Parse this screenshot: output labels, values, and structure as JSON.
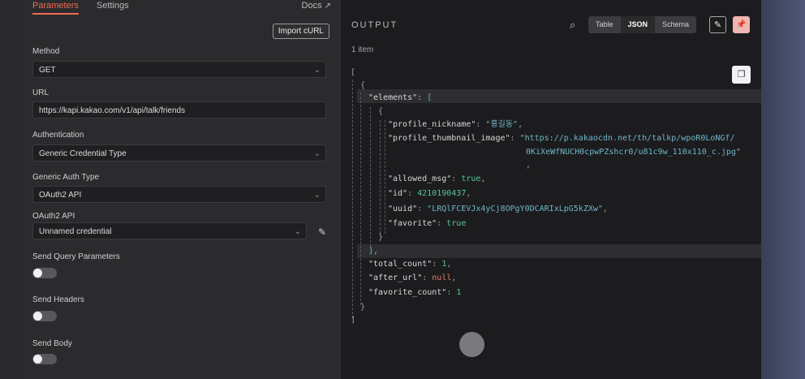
{
  "params": {
    "tabs": [
      "Parameters",
      "Settings"
    ],
    "docs_label": "Docs",
    "import_button": "Import cURL",
    "method": {
      "label": "Method",
      "value": "GET"
    },
    "url": {
      "label": "URL",
      "value": "https://kapi.kakao.com/v1/api/talk/friends"
    },
    "authentication": {
      "label": "Authentication",
      "value": "Generic Credential Type"
    },
    "generic_auth_type": {
      "label": "Generic Auth Type",
      "value": "OAuth2 API"
    },
    "oauth2_api": {
      "label": "OAuth2 API",
      "value": "Unnamed credential"
    },
    "toggles": [
      {
        "label": "Send Query Parameters",
        "on": false
      },
      {
        "label": "Send Headers",
        "on": false
      },
      {
        "label": "Send Body",
        "on": false
      }
    ]
  },
  "output": {
    "title": "OUTPUT",
    "count": "1 item",
    "views": [
      "Table",
      "JSON",
      "Schema"
    ],
    "active_view": "JSON",
    "json": {
      "key_elements": "\"elements\"",
      "key_nickname": "\"profile_nickname\"",
      "val_nickname": "\"홍길동\"",
      "key_thumb": "\"profile_thumbnail_image\"",
      "val_thumb_1": "\"https://p.kakaocdn.net/th/talkp/wpoR0LoNGf/",
      "val_thumb_2": "0KiXeWfNUCH0cpwPZshcr0/u81c9w_110x110_c.jpg\"",
      "key_allowed": "\"allowed_msg\"",
      "val_allowed": "true",
      "key_id": "\"id\"",
      "val_id": "4210190437",
      "key_uuid": "\"uuid\"",
      "val_uuid": "\"LRQlFCEVJx4yCj8OPgY0DCARIxLpG5kZXw\"",
      "key_favorite": "\"favorite\"",
      "val_favorite": "true",
      "key_total": "\"total_count\"",
      "val_total": "1",
      "key_after": "\"after_url\"",
      "val_after": "null",
      "key_favcount": "\"favorite_count\"",
      "val_favcount": "1"
    }
  },
  "colors": {
    "accent": "#ee6b4f",
    "panel": "#2b2b2d",
    "output_bg": "#1c1c1e",
    "string": "#6fb6c8",
    "number": "#56c69c"
  },
  "icons": [
    "search-icon",
    "external-link-icon",
    "chevron-down-icon",
    "pencil-icon",
    "pin-icon",
    "copy-icon"
  ]
}
